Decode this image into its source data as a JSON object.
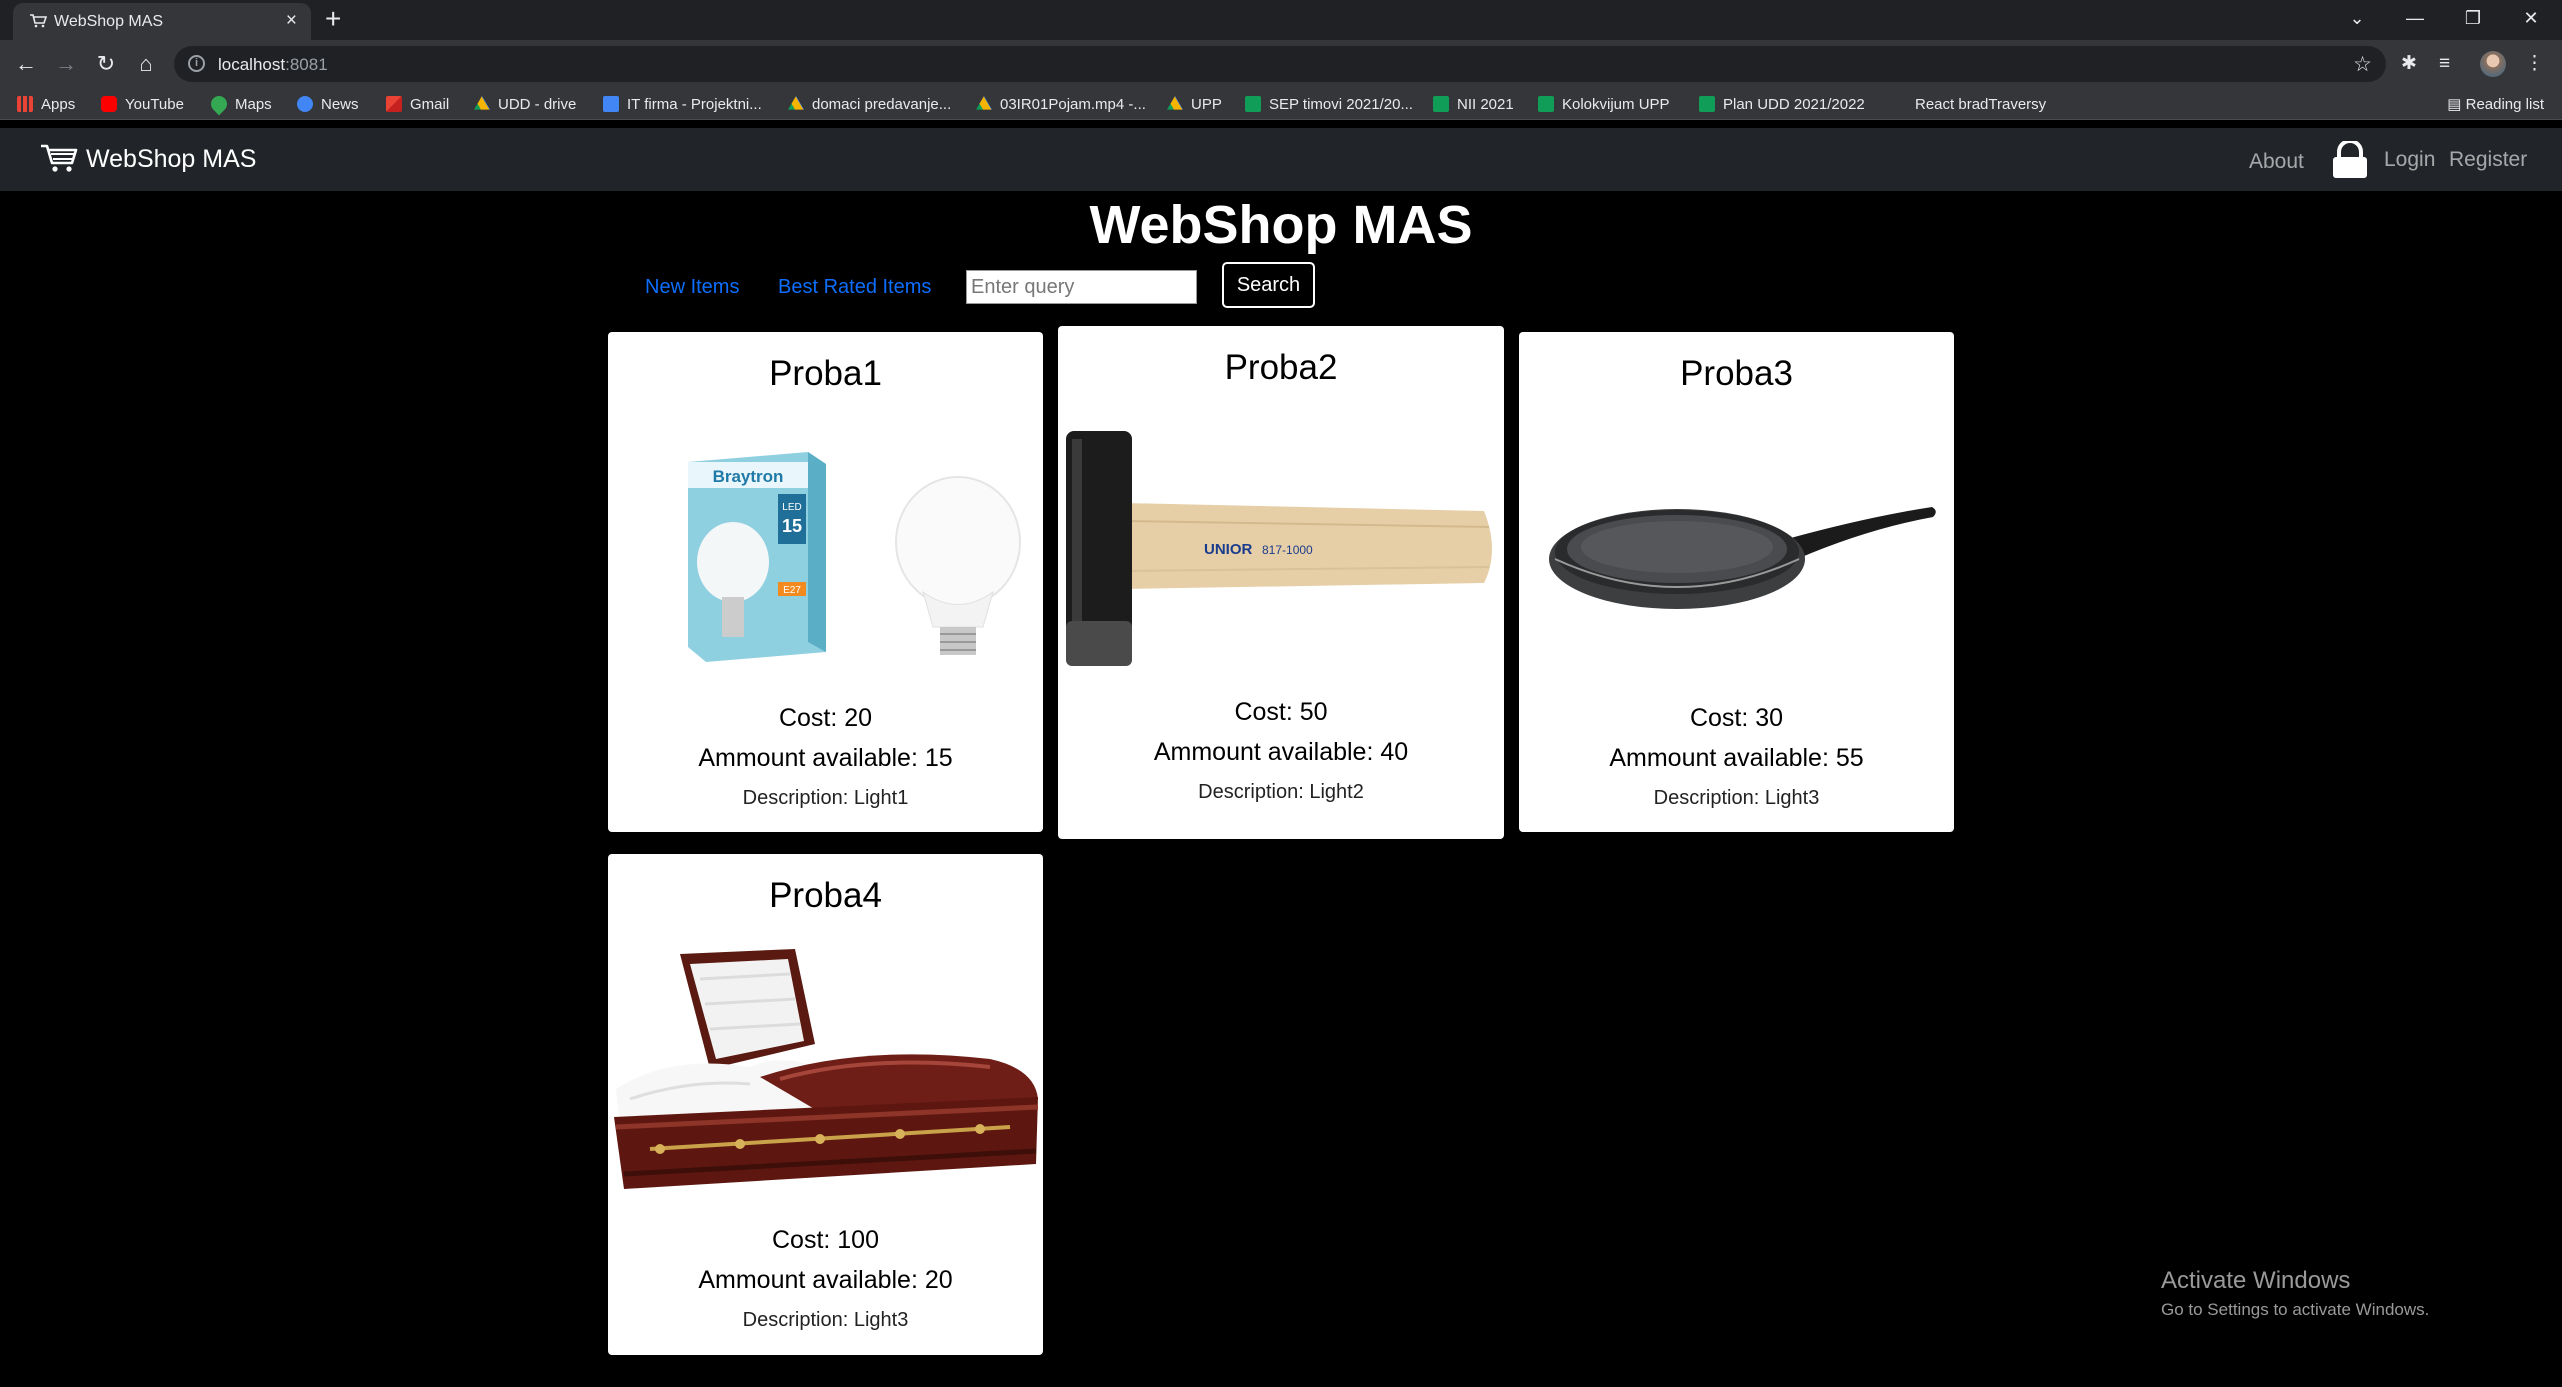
{
  "browser": {
    "tab_title": "WebShop MAS",
    "url_host": "localhost",
    "url_port": ":8081",
    "bookmarks": [
      {
        "label": "Apps",
        "icon": "apps-grid-icon"
      },
      {
        "label": "YouTube",
        "icon": "youtube-icon"
      },
      {
        "label": "Maps",
        "icon": "maps-icon"
      },
      {
        "label": "News",
        "icon": "news-icon"
      },
      {
        "label": "Gmail",
        "icon": "gmail-icon"
      },
      {
        "label": "UDD - drive",
        "icon": "drive-icon"
      },
      {
        "label": "IT firma - Projektni...",
        "icon": "docs-icon"
      },
      {
        "label": "domaci predavanje...",
        "icon": "drive-icon"
      },
      {
        "label": "03IR01Pojam.mp4 -...",
        "icon": "drive-icon"
      },
      {
        "label": "UPP",
        "icon": "drive-icon"
      },
      {
        "label": "SEP timovi 2021/20...",
        "icon": "sheets-icon"
      },
      {
        "label": "NII 2021",
        "icon": "sheets-icon"
      },
      {
        "label": "Kolokvijum UPP",
        "icon": "sheets-icon"
      },
      {
        "label": "Plan UDD 2021/2022",
        "icon": "sheets-icon"
      },
      {
        "label": "React bradTraversy",
        "icon": "page-icon"
      }
    ],
    "reading_list": "Reading list"
  },
  "nav": {
    "brand": "WebShop MAS",
    "about": "About",
    "login": "Login",
    "register": "Register"
  },
  "page": {
    "title": "WebShop MAS",
    "new_items": "New Items",
    "best_rated": "Best Rated Items",
    "search_placeholder": "Enter query",
    "search_button": "Search"
  },
  "products": [
    {
      "name": "Proba1",
      "cost": "Cost: 20",
      "amount": "Ammount available: 15",
      "description": "Description: Light1",
      "image": "led-bulb-box"
    },
    {
      "name": "Proba2",
      "cost": "Cost: 50",
      "amount": "Ammount available: 40",
      "description": "Description: Light2",
      "image": "rubber-mallet",
      "mallet_brand": "UNIOR",
      "mallet_code": "817-1000"
    },
    {
      "name": "Proba3",
      "cost": "Cost: 30",
      "amount": "Ammount available: 55",
      "description": "Description: Light3",
      "image": "frying-pan"
    },
    {
      "name": "Proba4",
      "cost": "Cost: 100",
      "amount": "Ammount available: 20",
      "description": "Description: Light3",
      "image": "casket"
    }
  ],
  "bulb_box": {
    "brand": "Braytron",
    "type": "LED",
    "watt": "15",
    "socket": "E27"
  },
  "os_watermark": {
    "title": "Activate Windows",
    "subtitle": "Go to Settings to activate Windows."
  }
}
